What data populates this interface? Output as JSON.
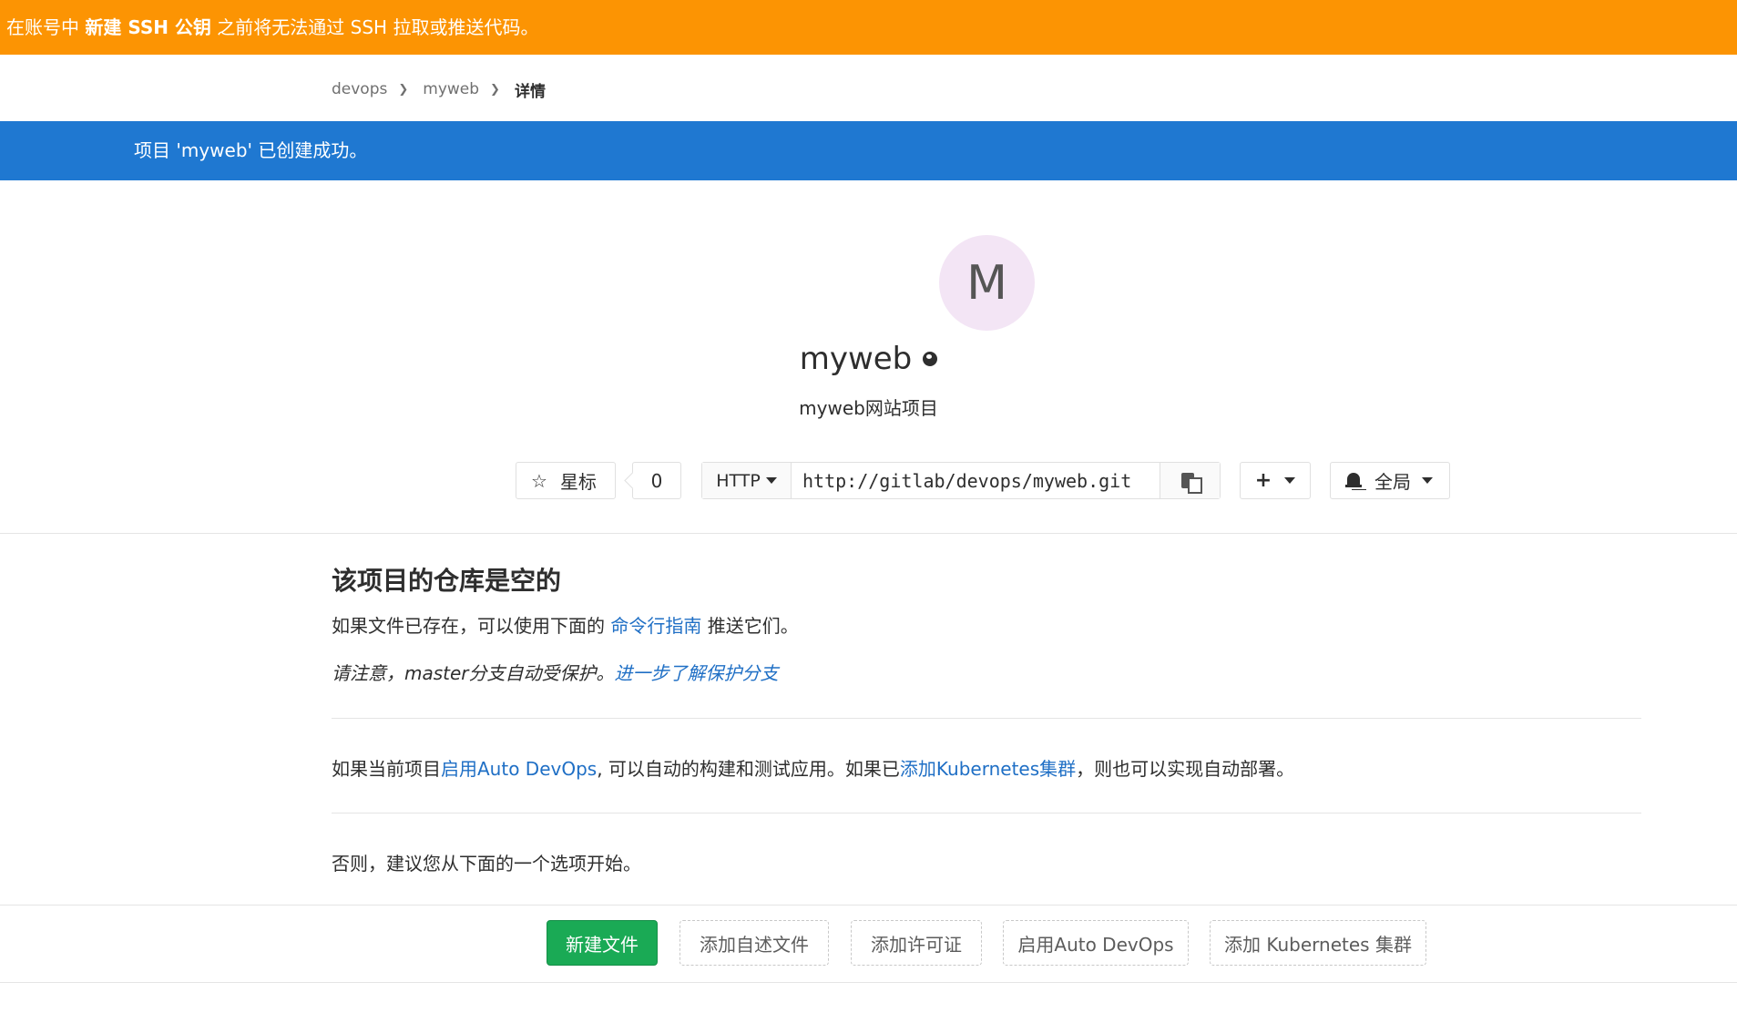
{
  "ssh_banner": {
    "prefix": "在账号中 ",
    "link": "新建 SSH 公钥",
    "suffix": " 之前将无法通过 SSH 拉取或推送代码。"
  },
  "breadcrumb": {
    "items": [
      "devops",
      "myweb",
      "详情"
    ]
  },
  "flash": {
    "message": "项目 'myweb' 已创建成功。"
  },
  "project": {
    "avatar_letter": "M",
    "name": "myweb",
    "description": "myweb网站项目"
  },
  "controls": {
    "star_label": "星标",
    "star_count": "0",
    "clone_protocol": "HTTP",
    "clone_url": "http://gitlab/devops/myweb.git",
    "add_label": "+",
    "notification_label": "全局"
  },
  "empty_repo": {
    "title": "该项目的仓库是空的",
    "line1_prefix": "如果文件已存在，可以使用下面的 ",
    "line1_link": "命令行指南",
    "line1_suffix": " 推送它们。",
    "line2_text": "请注意，master分支自动受保护。",
    "line2_link": "进一步了解保护分支",
    "devops_prefix": "如果当前项目",
    "devops_link": "启用Auto DevOps",
    "devops_middle": ", 可以自动的构建和测试应用。如果已",
    "k8s_link": "添加Kubernetes集群",
    "devops_suffix": "，则也可以实现自动部署。",
    "otherwise": "否则，建议您从下面的一个选项开始。"
  },
  "actions": {
    "new_file": "新建文件",
    "add_readme": "添加自述文件",
    "add_license": "添加许可证",
    "enable_devops": "启用Auto DevOps",
    "add_k8s": "添加 Kubernetes 集群"
  },
  "colors": {
    "ssh_banner": "#fc9403",
    "flash": "#1f78d1",
    "link": "#1f6fc5",
    "primary_button": "#1aaa55",
    "avatar_bg": "#f3e5f5"
  },
  "icons": {
    "star": "star-icon",
    "visibility": "globe-icon",
    "copy": "clipboard-icon",
    "add": "plus-icon",
    "notification": "bell-icon"
  }
}
